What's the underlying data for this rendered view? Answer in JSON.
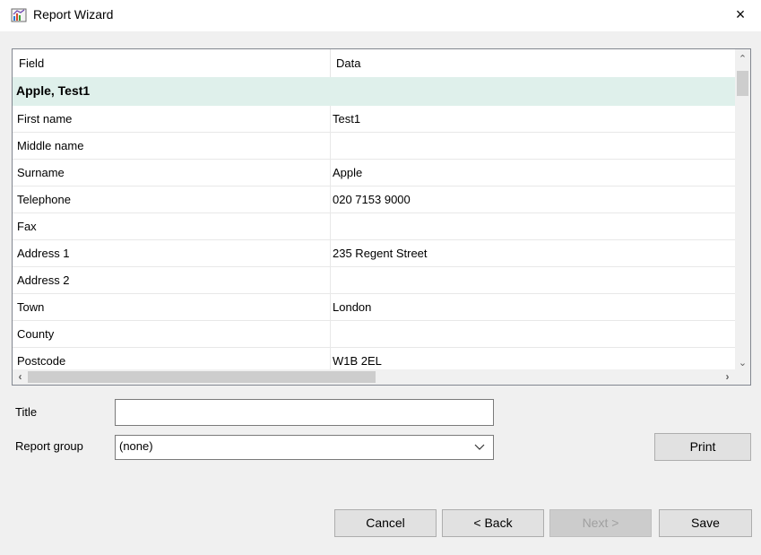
{
  "window": {
    "title": "Report Wizard",
    "close_glyph": "×"
  },
  "grid": {
    "columns": [
      "Field",
      "Data"
    ],
    "group_label": "Apple, Test1",
    "rows": [
      {
        "field": "First name",
        "data": "Test1"
      },
      {
        "field": "Middle name",
        "data": ""
      },
      {
        "field": "Surname",
        "data": "Apple"
      },
      {
        "field": "Telephone",
        "data": "020 7153 9000"
      },
      {
        "field": "Fax",
        "data": ""
      },
      {
        "field": "Address 1",
        "data": "235 Regent Street"
      },
      {
        "field": "Address 2",
        "data": ""
      },
      {
        "field": "Town",
        "data": "London"
      },
      {
        "field": "County",
        "data": ""
      },
      {
        "field": "Postcode",
        "data": "W1B 2EL"
      }
    ]
  },
  "form": {
    "title_label": "Title",
    "title_value": "",
    "report_group_label": "Report group",
    "report_group_value": "(none)"
  },
  "buttons": {
    "print": "Print",
    "cancel": "Cancel",
    "back": "< Back",
    "next": "Next >",
    "save": "Save"
  },
  "colors": {
    "group_row_bg": "#dff0eb",
    "window_bg": "#f0f0f0"
  },
  "icons": [
    "report-wizard-icon",
    "close-icon",
    "scroll-up-icon",
    "scroll-down-icon",
    "scroll-left-icon",
    "scroll-right-icon",
    "chevron-down-icon"
  ]
}
